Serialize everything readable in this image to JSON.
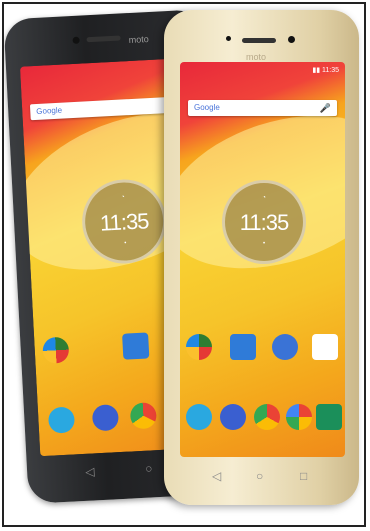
{
  "photo": {
    "subject": "moto-phones",
    "back_phone": {
      "brand": "moto",
      "search_label": "Google",
      "clock_time": "11:35",
      "apps": [
        "contacts-icon",
        "phone-icon",
        "messages-icon",
        "chrome-icon"
      ]
    },
    "front_phone": {
      "brand": "moto",
      "search_label": "Google",
      "clock_time": "11:35",
      "apps": [
        "photos-icon",
        "contacts-icon",
        "duo-icon",
        "play-store-icon"
      ]
    },
    "nav_back": "◁",
    "nav_home": "○",
    "nav_recent": "□",
    "colors": {
      "wall_red": "#e8283a",
      "wall_yellow": "#f9d233",
      "gold_body": "#efe3c0",
      "black_body": "#2a2b2e"
    }
  }
}
